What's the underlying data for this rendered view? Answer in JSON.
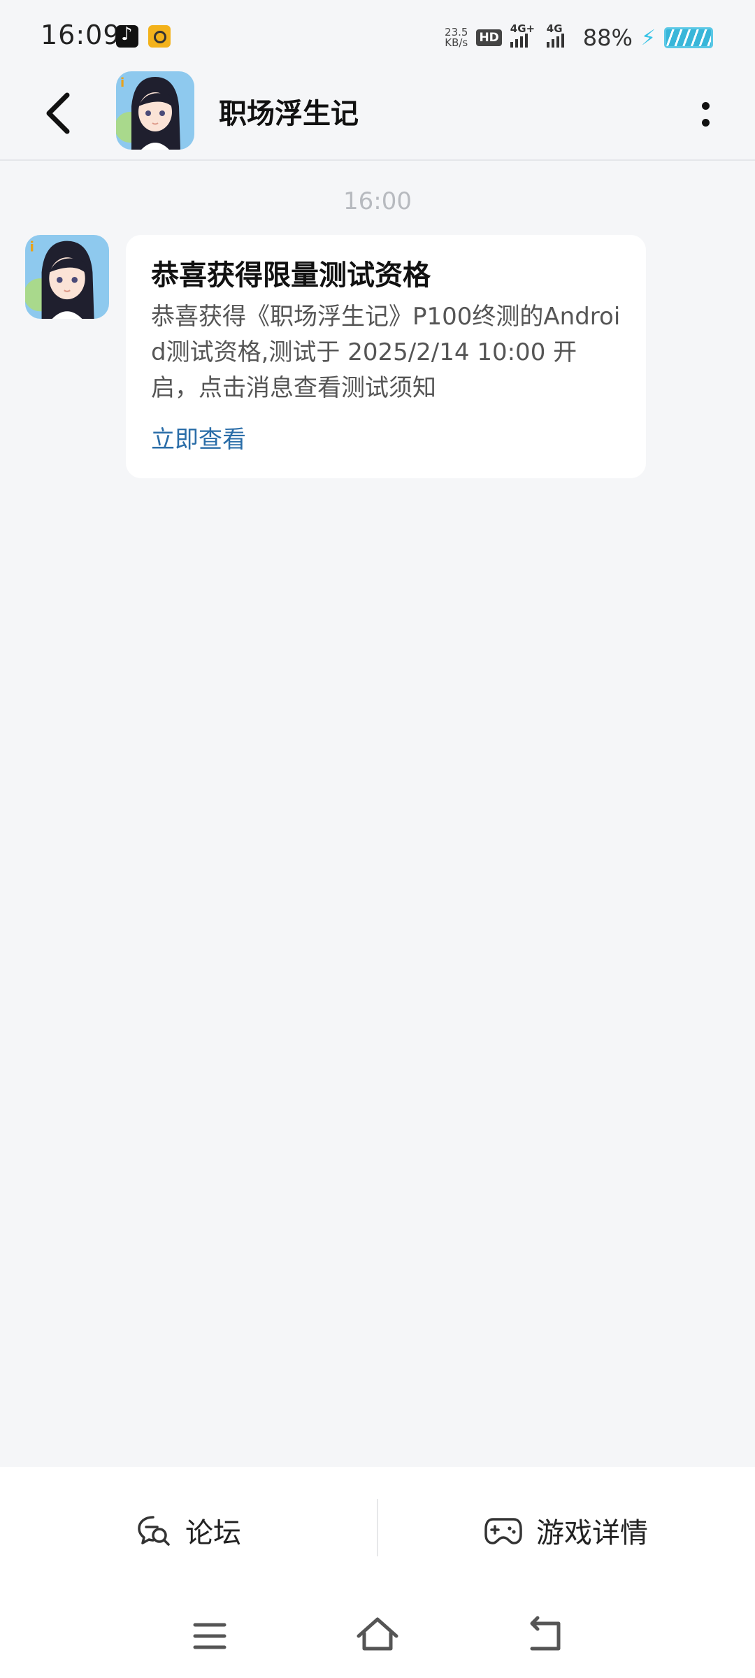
{
  "status_bar": {
    "time": "16:09",
    "net_speed_value": "23.5",
    "net_speed_unit": "KB/s",
    "hd_label": "HD",
    "signal1_label": "4G+",
    "signal2_label": "4G",
    "battery": "88%",
    "icons": [
      "tiktok-icon",
      "app-notification-icon",
      "hd-icon",
      "signal-icon",
      "battery-icon"
    ]
  },
  "header": {
    "title": "职场浮生记"
  },
  "chat": {
    "timestamp": "16:00",
    "message": {
      "title": "恭喜获得限量测试资格",
      "body": "恭喜获得《职场浮生记》P100终测的Android测试资格,测试于 2025/2/14 10:00 开启，点击消息查看测试须知",
      "link": "立即查看"
    }
  },
  "bottom_bar": {
    "forum_label": "论坛",
    "detail_label": "游戏详情"
  },
  "colors": {
    "background": "#f5f6f8",
    "link": "#2a6da8",
    "timestamp": "#b7babf"
  }
}
